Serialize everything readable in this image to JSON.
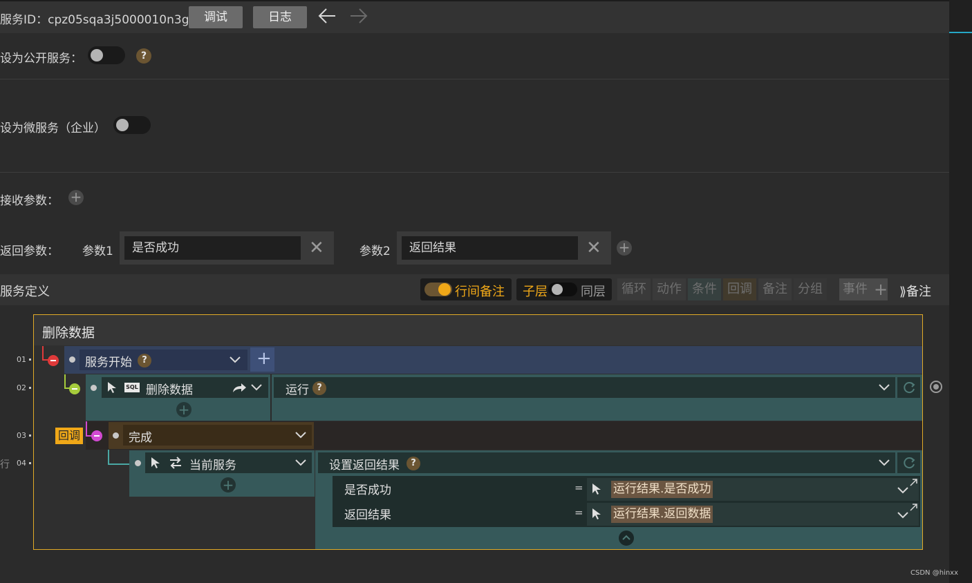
{
  "header": {
    "service_id_label": "服务ID：",
    "service_id": "cpz05sqa3j5000010n3g",
    "debug_button": "调试",
    "log_button": "日志"
  },
  "settings": {
    "public_label": "设为公开服务：",
    "public_enabled": false,
    "micro_label": "设为微服务（企业）",
    "micro_enabled": false
  },
  "params": {
    "receive_label": "接收参数：",
    "return_label": "返回参数：",
    "return_params": [
      {
        "name": "参数1",
        "value": "是否成功"
      },
      {
        "name": "参数2",
        "value": "返回结果"
      }
    ]
  },
  "definition": {
    "title": "服务定义",
    "inline_note_label": "行间备注",
    "inline_note_enabled": true,
    "child_layer_label": "子层",
    "same_layer_label": "同层",
    "tools": [
      "循环",
      "动作",
      "条件",
      "回调",
      "备注",
      "分组"
    ],
    "event_label": "事件",
    "note_label": "备注"
  },
  "flow": {
    "title": "删除数据",
    "rows": [
      {
        "num": "01",
        "step": "服务开始"
      },
      {
        "num": "02",
        "step": "删除数据",
        "badge": "SQL",
        "action": "运行"
      },
      {
        "num": "03",
        "tag": "回调",
        "step": "完成"
      },
      {
        "num": "04",
        "step": "当前服务",
        "action": "设置返回结果"
      }
    ],
    "assignments": [
      {
        "name": "是否成功",
        "op": "=",
        "value": "运行结果.是否成功"
      },
      {
        "name": "返回结果",
        "op": "=",
        "value": "运行结果.返回数据"
      }
    ],
    "left_edge_char": "行"
  },
  "footer": {
    "watermark": "CSDN @hinxx"
  },
  "colors": {
    "accent_gold": "#e2ab27",
    "toggle_on": "#f0a818",
    "callback_tag": "#f0a818",
    "row_start_bg": "#34425e",
    "row_teal_bg": "#36595a",
    "row_done_bg": "#4b3a22"
  },
  "icons": [
    "arrow-left-icon",
    "arrow-right-icon",
    "help-icon",
    "plus-icon",
    "close-icon",
    "chevron-down-icon",
    "cursor-icon",
    "sql-icon",
    "share-arrow-icon",
    "swap-icon",
    "refresh-icon",
    "target-icon",
    "expand-icon",
    "collapse-up-icon",
    "chevrons-right-icon"
  ]
}
